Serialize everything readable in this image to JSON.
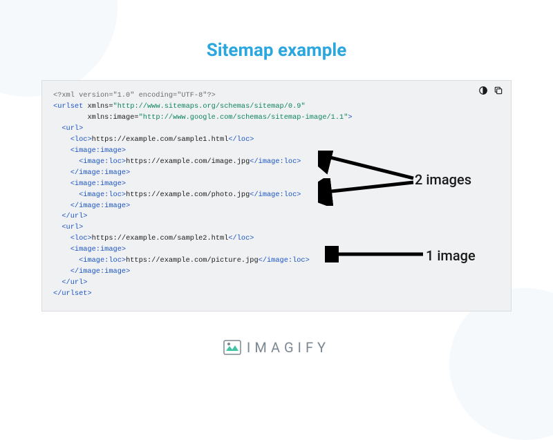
{
  "title": "Sitemap example",
  "annotations": {
    "two_images": "2 images",
    "one_image": "1 image"
  },
  "code": {
    "xml_decl": "<?xml version=\"1.0\" encoding=\"UTF-8\"?>",
    "urlset_open": "urlset",
    "xmlns_attr": "xmlns",
    "xmlns_val": "http://www.sitemaps.org/schemas/sitemap/0.9",
    "xmlns_image_attr": "xmlns:image",
    "xmlns_image_val": "http://www.google.com/schemas/sitemap-image/1.1",
    "url_tag": "url",
    "loc_tag": "loc",
    "image_image_tag": "image:image",
    "image_loc_tag": "image:loc",
    "loc1": "https://example.com/sample1.html",
    "img1": "https://example.com/image.jpg",
    "img2": "https://example.com/photo.jpg",
    "loc2": "https://example.com/sample2.html",
    "img3": "https://example.com/picture.jpg",
    "urlset_close": "/urlset"
  },
  "logo": {
    "text": "IMAGIFY"
  },
  "icons": {
    "theme": "theme-toggle-icon",
    "copy": "copy-icon"
  }
}
